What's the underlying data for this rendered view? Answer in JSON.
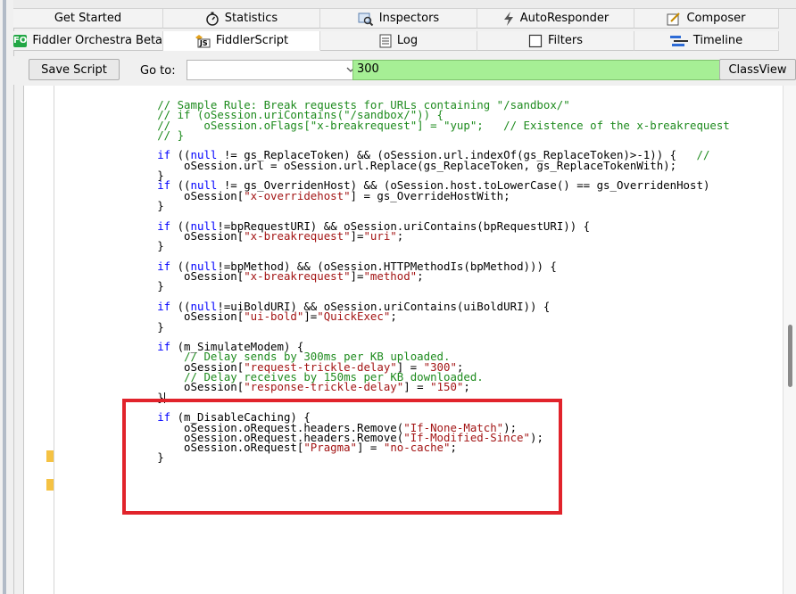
{
  "tabs_row1": [
    {
      "label": "Get Started",
      "icon": ""
    },
    {
      "label": "Statistics",
      "icon": "stopwatch-icon"
    },
    {
      "label": "Inspectors",
      "icon": "inspectors-icon"
    },
    {
      "label": "AutoResponder",
      "icon": "lightning-icon"
    },
    {
      "label": "Composer",
      "icon": "composer-icon"
    }
  ],
  "tabs_row2": [
    {
      "label": "Fiddler Orchestra Beta",
      "icon": "fo-icon",
      "badge": "FO"
    },
    {
      "label": "FiddlerScript",
      "icon": "js-icon",
      "badge": "JS"
    },
    {
      "label": "Log",
      "icon": "log-icon"
    },
    {
      "label": "Filters",
      "icon": "checkbox-icon"
    },
    {
      "label": "Timeline",
      "icon": "timeline-icon"
    }
  ],
  "toolbar": {
    "save_label": "Save Script",
    "goto_label": "Go to:",
    "search_value": "300",
    "classview_label": "ClassView"
  },
  "colors": {
    "keyword": "#0000ff",
    "comment": "#1e8b1e",
    "string": "#a31515",
    "search_bg": "#a6ef95",
    "highlight": "#e1232b",
    "marker": "#f5c243"
  },
  "code_lines": [
    [
      {
        "t": "        ",
        "c": ""
      },
      {
        "t": "// Sample Rule: Break requests for URLs containing \"/sandbox/\"",
        "c": "cm"
      }
    ],
    [
      {
        "t": "        ",
        "c": ""
      },
      {
        "t": "// if (oSession.uriContains(\"/sandbox/\")) {",
        "c": "cm"
      }
    ],
    [
      {
        "t": "        ",
        "c": ""
      },
      {
        "t": "//     oSession.oFlags[\"x-breakrequest\"] = \"yup\";   // Existence of the x-breakrequest",
        "c": "cm"
      }
    ],
    [
      {
        "t": "        ",
        "c": ""
      },
      {
        "t": "// }",
        "c": "cm"
      }
    ],
    [],
    [
      {
        "t": "        ",
        "c": ""
      },
      {
        "t": "if",
        "c": "kw"
      },
      {
        "t": " ((",
        "c": ""
      },
      {
        "t": "null",
        "c": "kw"
      },
      {
        "t": " != gs_ReplaceToken) && (oSession.url.indexOf(gs_ReplaceToken)>-1)) {   ",
        "c": ""
      },
      {
        "t": "//",
        "c": "cm"
      }
    ],
    [
      {
        "t": "            oSession.url = oSession.url.Replace(gs_ReplaceToken, gs_ReplaceTokenWith);",
        "c": ""
      }
    ],
    [
      {
        "t": "        }",
        "c": ""
      }
    ],
    [
      {
        "t": "        ",
        "c": ""
      },
      {
        "t": "if",
        "c": "kw"
      },
      {
        "t": " ((",
        "c": ""
      },
      {
        "t": "null",
        "c": "kw"
      },
      {
        "t": " != gs_OverridenHost) && (oSession.host.toLowerCase() == gs_OverridenHost)",
        "c": ""
      }
    ],
    [
      {
        "t": "            oSession[",
        "c": ""
      },
      {
        "t": "\"x-overridehost\"",
        "c": "st"
      },
      {
        "t": "] = gs_OverrideHostWith;",
        "c": ""
      }
    ],
    [
      {
        "t": "        }",
        "c": ""
      }
    ],
    [],
    [
      {
        "t": "        ",
        "c": ""
      },
      {
        "t": "if",
        "c": "kw"
      },
      {
        "t": " ((",
        "c": ""
      },
      {
        "t": "null",
        "c": "kw"
      },
      {
        "t": "!=bpRequestURI) && oSession.uriContains(bpRequestURI)) {",
        "c": ""
      }
    ],
    [
      {
        "t": "            oSession[",
        "c": ""
      },
      {
        "t": "\"x-breakrequest\"",
        "c": "st"
      },
      {
        "t": "]=",
        "c": ""
      },
      {
        "t": "\"uri\"",
        "c": "st"
      },
      {
        "t": ";",
        "c": ""
      }
    ],
    [
      {
        "t": "        }",
        "c": ""
      }
    ],
    [],
    [
      {
        "t": "        ",
        "c": ""
      },
      {
        "t": "if",
        "c": "kw"
      },
      {
        "t": " ((",
        "c": ""
      },
      {
        "t": "null",
        "c": "kw"
      },
      {
        "t": "!=bpMethod) && (oSession.HTTPMethodIs(bpMethod))) {",
        "c": ""
      }
    ],
    [
      {
        "t": "            oSession[",
        "c": ""
      },
      {
        "t": "\"x-breakrequest\"",
        "c": "st"
      },
      {
        "t": "]=",
        "c": ""
      },
      {
        "t": "\"method\"",
        "c": "st"
      },
      {
        "t": ";",
        "c": ""
      }
    ],
    [
      {
        "t": "        }",
        "c": ""
      }
    ],
    [],
    [
      {
        "t": "        ",
        "c": ""
      },
      {
        "t": "if",
        "c": "kw"
      },
      {
        "t": " ((",
        "c": ""
      },
      {
        "t": "null",
        "c": "kw"
      },
      {
        "t": "!=uiBoldURI) && oSession.uriContains(uiBoldURI)) {",
        "c": ""
      }
    ],
    [
      {
        "t": "            oSession[",
        "c": ""
      },
      {
        "t": "\"ui-bold\"",
        "c": "st"
      },
      {
        "t": "]=",
        "c": ""
      },
      {
        "t": "\"QuickExec\"",
        "c": "st"
      },
      {
        "t": ";",
        "c": ""
      }
    ],
    [
      {
        "t": "        }",
        "c": ""
      }
    ],
    [],
    [
      {
        "t": "        ",
        "c": ""
      },
      {
        "t": "if",
        "c": "kw"
      },
      {
        "t": " (m_SimulateModem) {",
        "c": ""
      }
    ],
    [
      {
        "t": "            ",
        "c": ""
      },
      {
        "t": "// Delay sends by 300ms per KB uploaded.",
        "c": "cm"
      }
    ],
    [
      {
        "t": "            oSession[",
        "c": ""
      },
      {
        "t": "\"request-trickle-delay\"",
        "c": "st"
      },
      {
        "t": "] = ",
        "c": ""
      },
      {
        "t": "\"300\"",
        "c": "st"
      },
      {
        "t": ";",
        "c": ""
      }
    ],
    [
      {
        "t": "            ",
        "c": ""
      },
      {
        "t": "// Delay receives by 150ms per KB downloaded.",
        "c": "cm"
      }
    ],
    [
      {
        "t": "            oSession[",
        "c": ""
      },
      {
        "t": "\"response-trickle-delay\"",
        "c": "st"
      },
      {
        "t": "] = ",
        "c": ""
      },
      {
        "t": "\"150\"",
        "c": "st"
      },
      {
        "t": ";",
        "c": ""
      }
    ],
    [
      {
        "t": "        }",
        "c": "",
        "caret": true
      }
    ],
    [],
    [
      {
        "t": "        ",
        "c": ""
      },
      {
        "t": "if",
        "c": "kw"
      },
      {
        "t": " (m_DisableCaching) {",
        "c": ""
      }
    ],
    [
      {
        "t": "            oSession.oRequest.headers.Remove(",
        "c": ""
      },
      {
        "t": "\"If-None-Match\"",
        "c": "st"
      },
      {
        "t": ");",
        "c": ""
      }
    ],
    [
      {
        "t": "            oSession.oRequest.headers.Remove(",
        "c": ""
      },
      {
        "t": "\"If-Modified-Since\"",
        "c": "st"
      },
      {
        "t": ");",
        "c": ""
      }
    ],
    [
      {
        "t": "            oSession.oRequest[",
        "c": ""
      },
      {
        "t": "\"Pragma\"",
        "c": "st"
      },
      {
        "t": "] = ",
        "c": ""
      },
      {
        "t": "\"no-cache\"",
        "c": "st"
      },
      {
        "t": ";",
        "c": ""
      }
    ],
    [
      {
        "t": "        }",
        "c": ""
      }
    ]
  ]
}
